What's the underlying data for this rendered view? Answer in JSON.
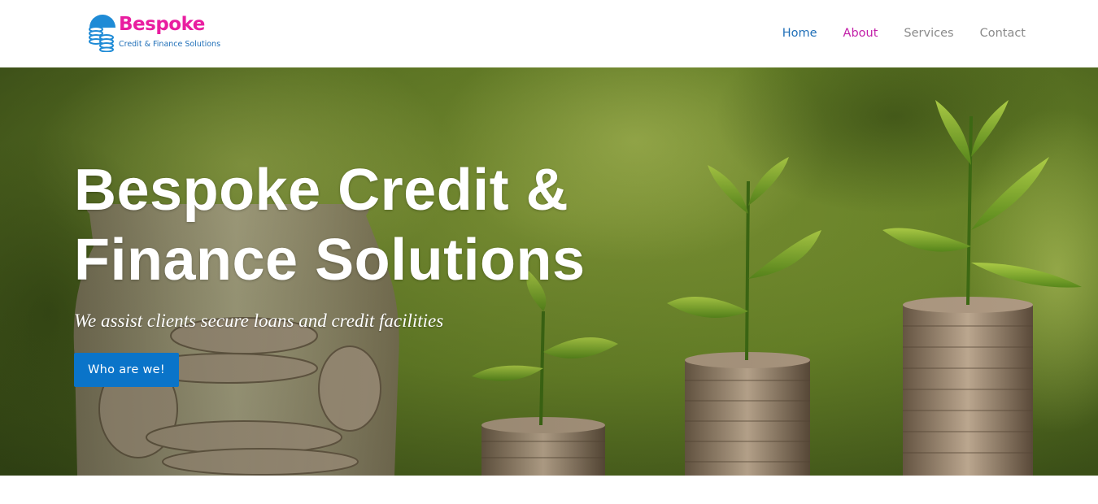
{
  "brand": {
    "name": "Bespoke",
    "tagline": "Credit & Finance Solutions",
    "name_color": "#e91ea0",
    "tagline_color": "#1f6fb8",
    "mark_color": "#1f8bd6"
  },
  "nav": {
    "items": [
      {
        "label": "Home",
        "color": "#1f6fb8"
      },
      {
        "label": "About",
        "color": "#c21fa8"
      },
      {
        "label": "Services",
        "color": "#8a8a8a"
      },
      {
        "label": "Contact",
        "color": "#8a8a8a"
      }
    ]
  },
  "hero": {
    "title": "Bespoke Credit & Finance Solutions",
    "subtitle": "We assist clients secure loans and credit facilities",
    "button_label": "Who are we!",
    "button_color": "#0a74c9",
    "image_description_icons": [
      "coin-jar-icon",
      "coin-stack-icon",
      "seedling-icon"
    ]
  }
}
